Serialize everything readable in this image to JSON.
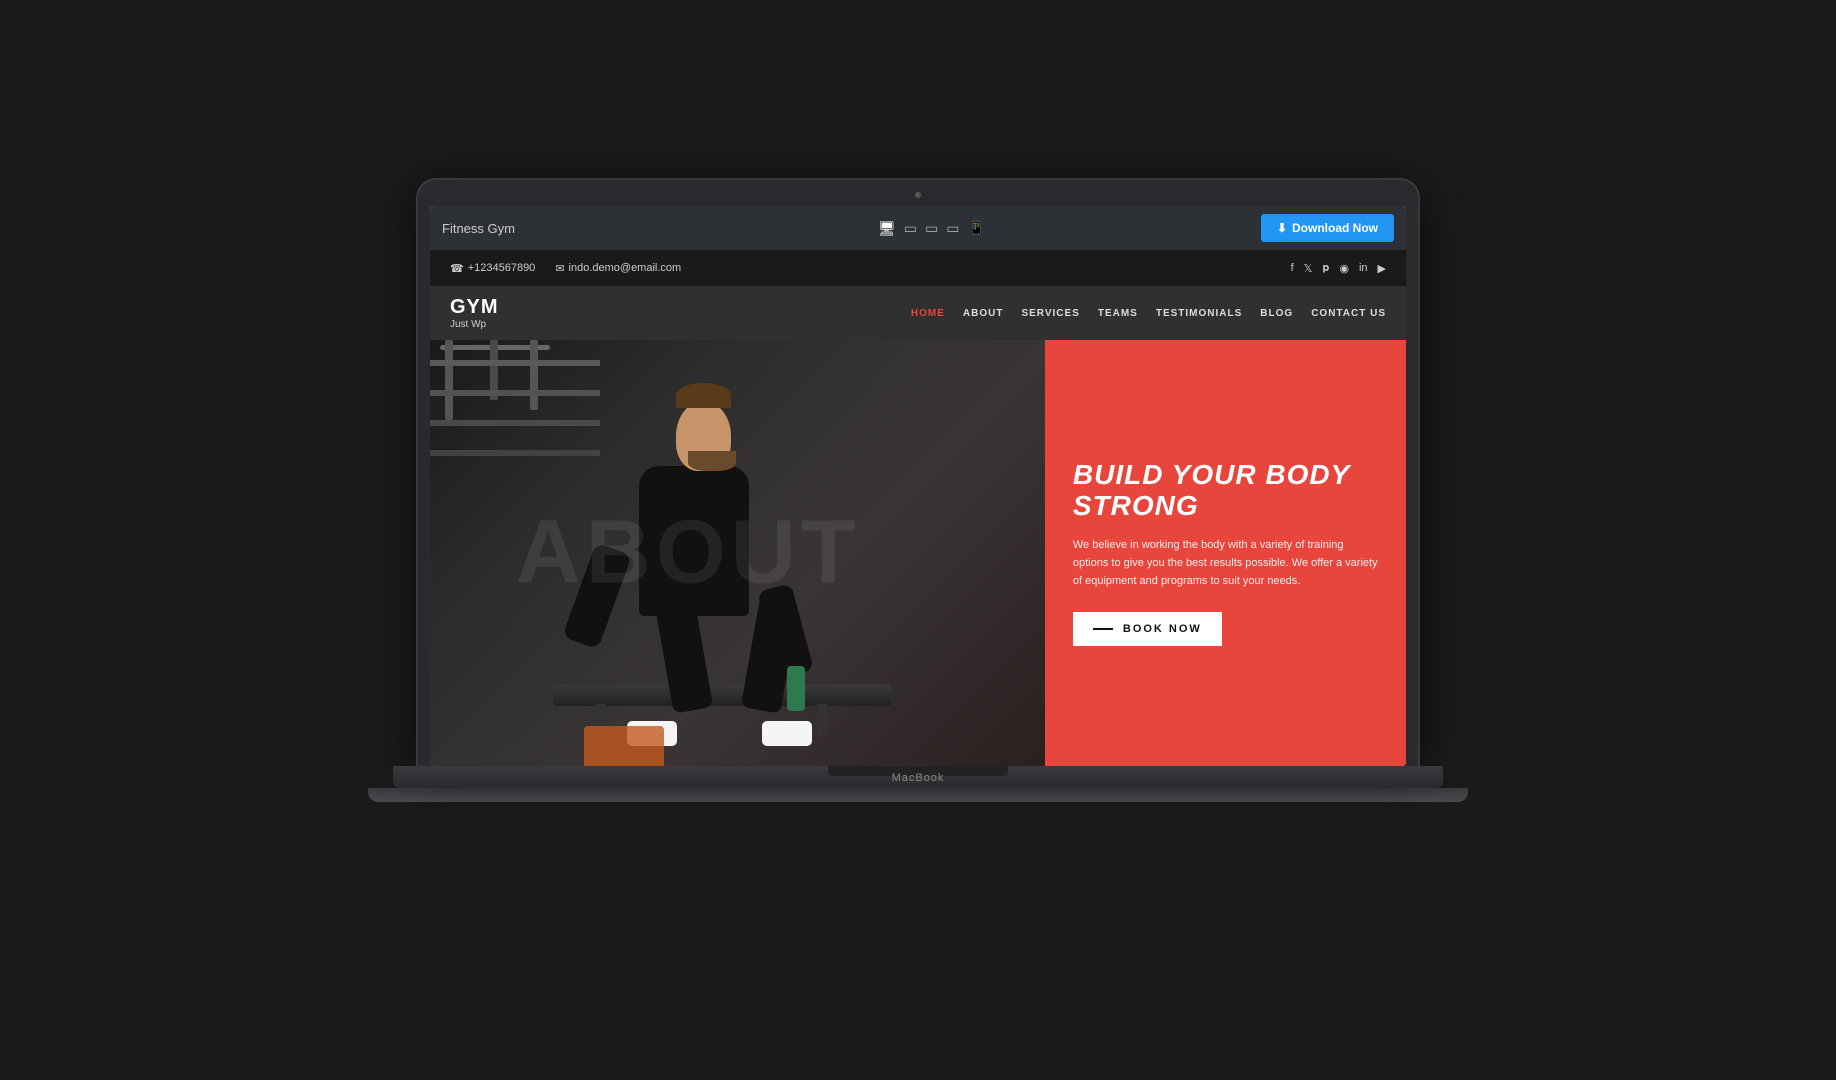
{
  "toolbar": {
    "title": "Fitness Gym",
    "download_label": "Download Now",
    "download_icon": "⬇",
    "devices": [
      "🖥",
      "▭",
      "▭",
      "▭",
      "📱"
    ]
  },
  "contact_bar": {
    "phone_icon": "📞",
    "phone": "+1234567890",
    "email_icon": "✉",
    "email": "indo.demo@email.com",
    "socials": [
      "f",
      "t",
      "p",
      "📷",
      "in",
      "▶"
    ]
  },
  "nav": {
    "logo_title": "GYM",
    "logo_sub": "Just Wp",
    "links": [
      "HOME",
      "ABOUT",
      "SERVICES",
      "TEAMS",
      "TESTIMONIALS",
      "BLOG",
      "CONTACT US"
    ]
  },
  "hero": {
    "headline_line1": "BUILD YOUR BODY",
    "headline_line2": "STRONG",
    "description": "We believe in working the body with a variety of training options to give you the best results possible. We offer a variety of equipment and programs to suit your needs.",
    "cta_label": "BOOK NOW",
    "about_watermark": "About"
  },
  "laptop": {
    "brand": "MacBook"
  },
  "colors": {
    "toolbar_bg": "#2d3035",
    "contact_bg": "#1a1a1a",
    "nav_bg": "rgba(30,30,30,0.92)",
    "hero_accent": "#e8453c",
    "download_btn": "#2196f3",
    "dark_maroon": "#6b1a1a"
  }
}
